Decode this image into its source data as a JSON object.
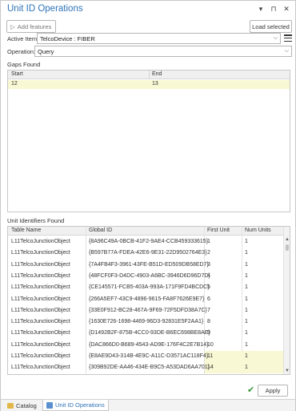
{
  "window": {
    "title": "Unit ID Operations",
    "title_icons": [
      "▾",
      "⊓",
      "✕"
    ]
  },
  "toolbar": {
    "add_features_label": "Add features",
    "load_selected_label": "Load selected"
  },
  "active_item": {
    "label": "Active Item:",
    "value": "TelcoDevice : FIBER"
  },
  "operation": {
    "label": "Operation:",
    "value": "Query"
  },
  "gaps": {
    "section_label": "Gaps Found",
    "columns": [
      "Start",
      "End"
    ],
    "rows": [
      {
        "start": "12",
        "end": "13"
      }
    ]
  },
  "units": {
    "section_label": "Unit Identifiers Found",
    "columns": [
      "Table Name",
      "Global ID",
      "First Unit",
      "Num Units"
    ],
    "rows": [
      {
        "table": "L11TelcoJunctionObject",
        "gid": "{8A96C49A-0BCB-41F2-9AE4-CCB459333615}",
        "first": "1",
        "num": "1",
        "highlight": false
      },
      {
        "table": "L11TelcoJunctionObject",
        "gid": "{B597B77A-FDEA-42E6-9E31-22D9502764E3}",
        "first": "2",
        "num": "1",
        "highlight": false
      },
      {
        "table": "L11TelcoJunctionObject",
        "gid": "{7A4FB4F3-3961-43FE-B51D-ED509DB58ED7}",
        "first": "3",
        "num": "1",
        "highlight": false
      },
      {
        "table": "L11TelcoJunctionObject",
        "gid": "{48FCF0F3-D4DC-4903-A6BC-3946D6D96D7D}",
        "first": "4",
        "num": "1",
        "highlight": false
      },
      {
        "table": "L11TelcoJunctionObject",
        "gid": "{CE145571-FCB5-403A-993A-171F9FD4BCDC}",
        "first": "5",
        "num": "1",
        "highlight": false
      },
      {
        "table": "L11TelcoJunctionObject",
        "gid": "{266A5EF7-43C9-4896-9615-FA8F7626E9E7}",
        "first": "6",
        "num": "1",
        "highlight": false
      },
      {
        "table": "L11TelcoJunctionObject",
        "gid": "{33E0F912-BC28-467A-9F69-72F5DFD38A7C}",
        "first": "7",
        "num": "1",
        "highlight": false
      },
      {
        "table": "L11TelcoJunctionObject",
        "gid": "{1630E726-1698-4469-96D3-92831E5F2AA1}",
        "first": "8",
        "num": "1",
        "highlight": false
      },
      {
        "table": "L11TelcoJunctionObject",
        "gid": "{D1492B2F-875B-4CC0-93DE-B6EC698BE8AE}",
        "first": "9",
        "num": "1",
        "highlight": false
      },
      {
        "table": "L11TelcoJunctionObject",
        "gid": "{DAC866D0-B689-4543-AD9E-176F4C2E7B14}",
        "first": "10",
        "num": "1",
        "highlight": false
      },
      {
        "table": "L11TelcoJunctionObject",
        "gid": "{E8AE9D43-314B-4E9C-A11C-D3571AC118F4}",
        "first": "11",
        "num": "1",
        "highlight": true
      },
      {
        "table": "L11TelcoJunctionObject",
        "gid": "{309B92DE-AA46-434E-B9C5-A53DAD6AA701}",
        "first": "14",
        "num": "1",
        "highlight": true
      }
    ]
  },
  "footer": {
    "apply_label": "Apply",
    "status_icon": "check-icon"
  },
  "tabs": [
    {
      "label": "Catalog",
      "active": false
    },
    {
      "label": "Unit ID Operations",
      "active": true
    }
  ],
  "colors": {
    "accent": "#2e73b8",
    "highlight_row": "#f8f8d4",
    "success": "#3a9a3a"
  }
}
